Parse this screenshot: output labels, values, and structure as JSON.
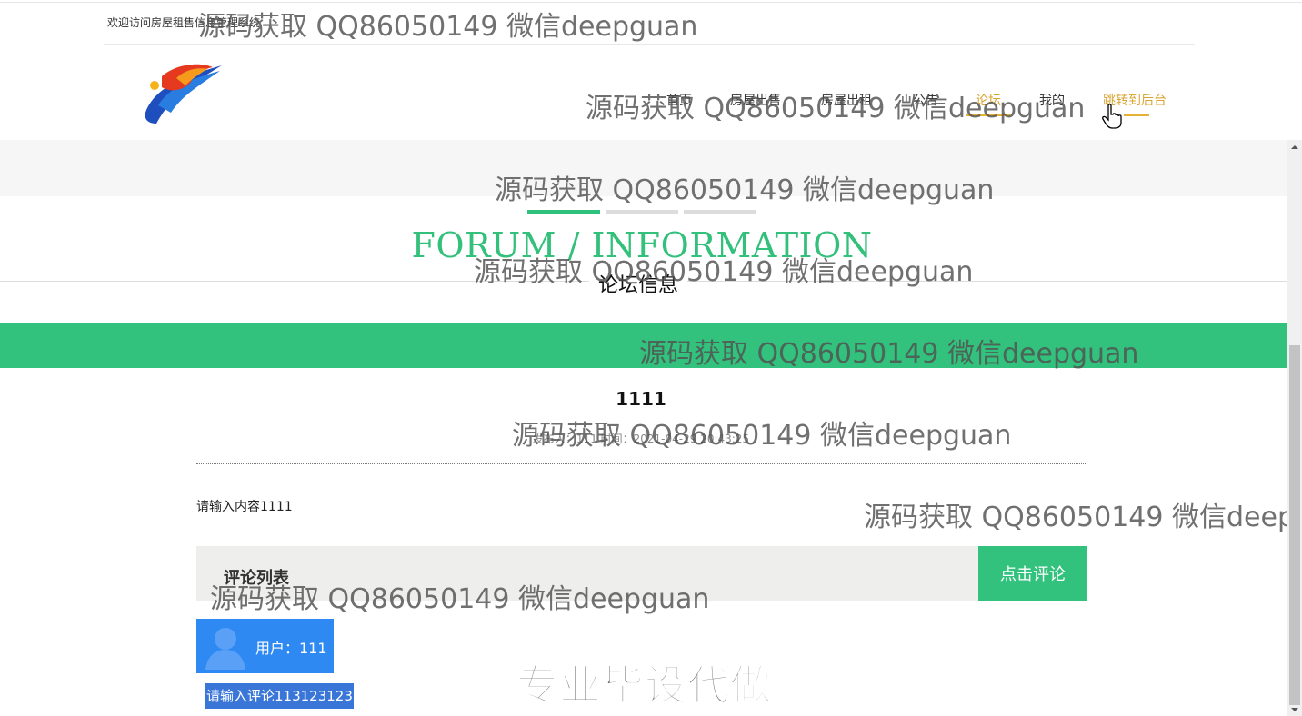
{
  "header": {
    "welcome": "欢迎访问房屋租售信息管理系统",
    "nav": [
      {
        "label": "首页",
        "active": false
      },
      {
        "label": "房屋出售",
        "active": false
      },
      {
        "label": "房屋出租",
        "active": false
      },
      {
        "label": "公告",
        "active": false
      },
      {
        "label": "论坛",
        "active": true
      },
      {
        "label": "我的",
        "active": false
      },
      {
        "label": "跳转到后台",
        "active": false
      }
    ]
  },
  "section": {
    "title_en": "FORUM / INFORMATION",
    "title_cn": "论坛信息"
  },
  "post": {
    "title": "1111",
    "meta": "发布人：111 时间：2021-04-29 20:43:25",
    "content": "请输入内容1111"
  },
  "comments": {
    "label": "评论列表",
    "button": "点击评论",
    "items": [
      {
        "user": "用户：111",
        "text": "请输入评论113123123"
      }
    ]
  },
  "watermarks": {
    "text": "源码获取 QQ86050149 微信deepguan",
    "cut_text": "源码获取 QQ86050149 微信deepg",
    "big": "专业毕设代做"
  },
  "colors": {
    "accent_green": "#33c27d",
    "nav_active": "#d8a531",
    "user_blue": "#2e89f3"
  },
  "icons": [
    "logo-icon",
    "hand-cursor-icon",
    "avatar-icon",
    "scroll-up-icon",
    "scroll-down-icon"
  ]
}
